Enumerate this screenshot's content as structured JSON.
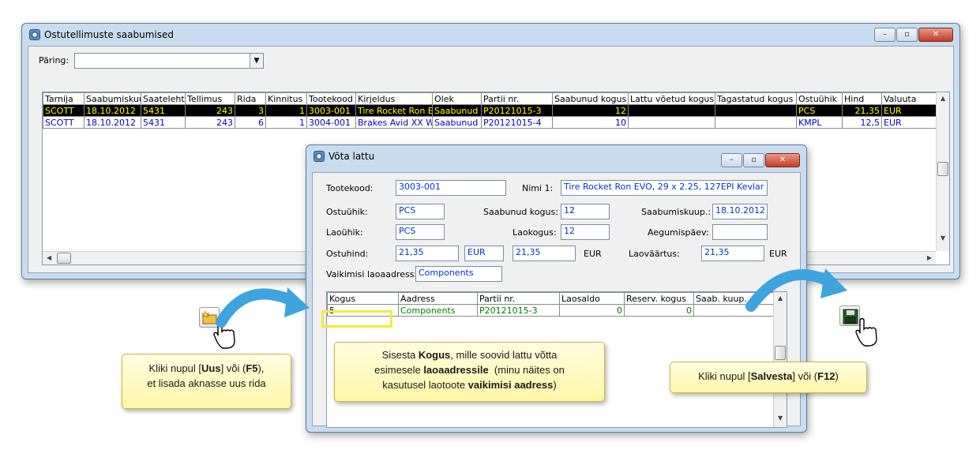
{
  "main_window": {
    "title": "Ostutellimuste saabumised",
    "buttons": {
      "minimize": "–",
      "maximize": "▫",
      "close": "✕"
    },
    "query_label": "Päring:",
    "query_value": "",
    "table": {
      "columns": [
        "Tarnija",
        "Saabumiskuu",
        "Saateleht",
        "Tellimus",
        "Rida",
        "Kinnitus",
        "Tootekood",
        "Kirjeldus",
        "Olek",
        "Partii nr.",
        "Saabunud kogus",
        "Lattu võetud kogus",
        "Tagastatud kogus",
        "Ostuühik",
        "Hind",
        "Valuuta"
      ],
      "rows": [
        [
          "SCOTT",
          "18.10.2012",
          "5431",
          "243",
          "3",
          "1",
          "3003-001",
          "Tire Rocket Ron E",
          "Saabunud",
          "P20121015-3",
          "12",
          "",
          "",
          "PCS",
          "21,35",
          "EUR"
        ],
        [
          "SCOTT",
          "18.10.2012",
          "5431",
          "243",
          "6",
          "1",
          "3004-001",
          "Brakes Avid XX W",
          "Saabunud",
          "P20121015-4",
          "10",
          "",
          "",
          "KMPL",
          "12,5",
          "EUR"
        ]
      ]
    }
  },
  "dialog": {
    "title": "Võta lattu",
    "fields": {
      "tootekood_label": "Tootekood:",
      "tootekood": "3003-001",
      "nimi_label": "Nimi 1:",
      "nimi": "Tire Rocket Ron EVO, 29 x 2.25, 127EPI Kevlar",
      "ostuuhik_label": "Ostuühik:",
      "ostuuhik": "PCS",
      "saabunud_kogus_label": "Saabunud kogus:",
      "saabunud_kogus": "12",
      "saabumiskuup_label": "Saabumiskuup.:",
      "saabumiskuup": "18.10.2012",
      "laouhik_label": "Laoühik:",
      "laouhik": "PCS",
      "laokogus_label": "Laokogus:",
      "laokogus": "12",
      "aegumispaev_label": "Aegumispäev:",
      "aegumispaev": "",
      "ostuhind_label": "Ostuhind:",
      "ostuhind": "21,35",
      "ostuhind_valuuta": "EUR",
      "hind2": "21,35",
      "hind2_valuuta": "EUR",
      "laovaartus_label": "Laoväärtus:",
      "laovaartus": "21,35",
      "laovaartus_valuuta": "EUR",
      "vaikimisi_label": "Vaikimisi laoaadress:",
      "vaikimisi": "Components"
    },
    "grid": {
      "columns": [
        "Kogus",
        "Aadress",
        "Partii nr.",
        "Laosaldo",
        "Reserv. kogus",
        "Saab. kuup."
      ],
      "row": [
        "5",
        "Components",
        "P20121015-3",
        "0",
        "0",
        ""
      ]
    }
  },
  "callouts": {
    "uus": {
      "line1_pre": "Kliki nupul [",
      "line1_bold": "Uus",
      "line1_mid": "] või (",
      "line1_key": "F5",
      "line1_post": "),",
      "line2": "et lisada aknasse uus rida"
    },
    "kogus": {
      "l1_pre": "Sisesta ",
      "l1_bold": "Kogus",
      "l1_post": ", mille soovid lattu võtta",
      "l2_pre": "esimesele ",
      "l2_bold": "laoaadressile",
      "l2_post": "  (minu näites on",
      "l3_pre": "kasutusel laotoote ",
      "l3_bold": "vaikimisi aadress",
      "l3_post": ")"
    },
    "salvesta": {
      "pre": "Kliki nupul [",
      "bold": "Salvesta",
      "mid": "] või (",
      "key": "F12",
      "post": ")"
    }
  },
  "colors": {
    "selected_row_bg": "#000000",
    "selected_row_fg": "#ffff00",
    "value_blue": "#0033cc",
    "green_text": "#008000",
    "arrow_blue": "#3da4e0"
  }
}
